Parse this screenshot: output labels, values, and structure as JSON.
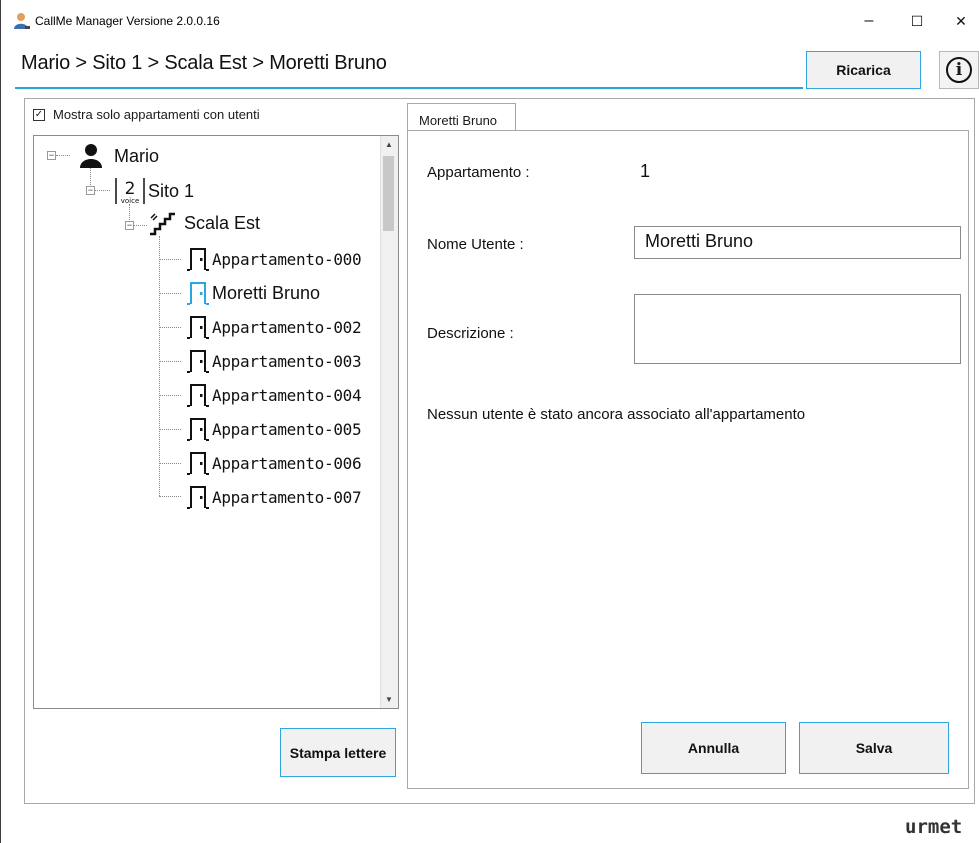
{
  "window": {
    "title": "CallMe Manager Versione 2.0.0.16",
    "minimize": "–",
    "maximize": "☐",
    "close": "✕"
  },
  "header": {
    "breadcrumb": "Mario > Sito 1 > Scala Est > Moretti Bruno",
    "reload_label": "Ricarica",
    "info_icon_glyph": "i"
  },
  "tree": {
    "filter_checkbox_label": "Mostra solo appartamenti con utenti",
    "filter_checked": true,
    "root": {
      "label": "Mario",
      "icon": "user-icon"
    },
    "site": {
      "label": "Sito 1",
      "icon": "voice-site-icon",
      "icon_text": "2",
      "icon_subtext": "voice"
    },
    "stair": {
      "label": "Scala Est",
      "icon": "stairs-icon"
    },
    "apartments": [
      {
        "label": "Appartamento-000",
        "selected": false
      },
      {
        "label": "Moretti Bruno",
        "selected": true
      },
      {
        "label": "Appartamento-002",
        "selected": false
      },
      {
        "label": "Appartamento-003",
        "selected": false
      },
      {
        "label": "Appartamento-004",
        "selected": false
      },
      {
        "label": "Appartamento-005",
        "selected": false
      },
      {
        "label": "Appartamento-006",
        "selected": false
      },
      {
        "label": "Appartamento-007",
        "selected": false
      }
    ],
    "print_letters_label": "Stampa lettere"
  },
  "detail": {
    "tab_label": "Moretti Bruno",
    "apartment_label": "Appartamento :",
    "apartment_value": "1",
    "user_name_label": "Nome Utente :",
    "user_name_value": "Moretti Bruno",
    "description_label": "Descrizione :",
    "description_value": "",
    "message": "Nessun utente è stato ancora associato all'appartamento",
    "cancel_label": "Annulla",
    "save_label": "Salva"
  },
  "footer": {
    "brand": "urmet"
  },
  "colors": {
    "accent": "#29a3d9",
    "selected_icon": "#2aa6e0",
    "border": "#a8a8a8"
  }
}
